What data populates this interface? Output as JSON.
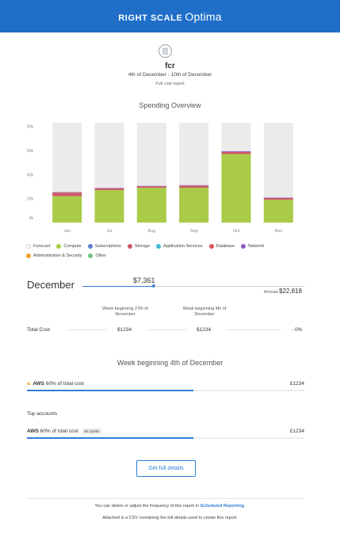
{
  "header": {
    "brand_bold": "RIGHT SCALE",
    "brand_light": "Optima",
    "color": "#1f6fc9"
  },
  "report": {
    "icon": "document-icon",
    "name": "fcr",
    "dates": "4th of December - 10th of December",
    "type": "Full cost report"
  },
  "spending": {
    "title": "Spending Overview"
  },
  "chart_data": {
    "type": "bar",
    "stacked": true,
    "categories": [
      "Jun",
      "Jul",
      "Aug",
      "Sep",
      "Oct",
      "Nov"
    ],
    "y_ticks": [
      "0k",
      "20k",
      "40k",
      "60k",
      "80k"
    ],
    "ylim": [
      0,
      83000
    ],
    "grid": false,
    "series": [
      {
        "name": "Compute",
        "color": "#a9cb47",
        "values": [
          22000,
          27000,
          29000,
          29000,
          57000,
          19000
        ]
      },
      {
        "name": "Storage",
        "color": "#d05a6a",
        "values": [
          3000,
          1500,
          1200,
          1800,
          1800,
          1500
        ]
      },
      {
        "name": "Subscriptions",
        "color": "#5b7fd0",
        "values": [
          0,
          0,
          0,
          0,
          0,
          0
        ]
      },
      {
        "name": "Network",
        "color": "#8e5cc8",
        "values": [
          300,
          300,
          300,
          300,
          600,
          300
        ]
      }
    ],
    "forecast_total": [
      83000,
      83000,
      83000,
      83000,
      83000,
      83000
    ],
    "forecast_color": "#ebebeb",
    "legend": [
      {
        "name": "Forecast",
        "color": "#ffffff",
        "dotted": true
      },
      {
        "name": "Compute",
        "color": "#a9cb47"
      },
      {
        "name": "Subscriptions",
        "color": "#5b7fd0"
      },
      {
        "name": "Storage",
        "color": "#d05a6a"
      },
      {
        "name": "Application Services",
        "color": "#45b6d6"
      },
      {
        "name": "Database",
        "color": "#d9534f"
      },
      {
        "name": "Network",
        "color": "#8e5cc8"
      },
      {
        "name": "Administration & Security",
        "color": "#f0a22a"
      },
      {
        "name": "Other",
        "color": "#6cc47d"
      }
    ]
  },
  "month_summary": {
    "month": "December",
    "current": "$7,361",
    "current_fraction": 0.322,
    "forecast_label": "forecast",
    "forecast_value": "$22,818"
  },
  "cost_table": {
    "col1_head": "Week beginning 27th of November",
    "col2_head": "Week beginning 4th of December",
    "row_label": "Total Cost",
    "col1_value": "$1234",
    "col2_value": "$1234",
    "change": "- 0%"
  },
  "week": {
    "title": "Week beginning 4th of December",
    "aws_label": "AWS",
    "aws_pct_text": "60% of total cost",
    "aws_value": "£1234",
    "aws_fraction": 0.6
  },
  "top_accounts": {
    "title": "Top accounts",
    "rows": [
      {
        "name": "AWS",
        "pct_text": "60% of total cost",
        "id_tag": "ID 12345",
        "value": "£1234",
        "fraction": 0.6
      }
    ]
  },
  "cta": {
    "label": "Get full details"
  },
  "footer": {
    "line1_prefix": "You can delete or adjust the frequency of this report in",
    "line1_link": "Scheduled Reporting",
    "line1_suffix": ".",
    "line2": "Attached is a CSV containing the full details used to create this report."
  }
}
